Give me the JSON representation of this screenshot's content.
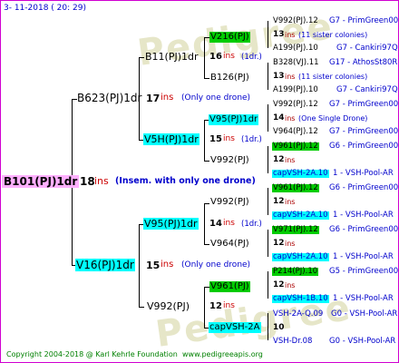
{
  "date": "3-  11-2018  (  20:  29)",
  "copyright": "Copyright 2004-2018 @ Karl Kehrle Foundation",
  "website": "www.pedigreeapis.org",
  "watermark_text": "Pedigree",
  "gen1": {
    "name": "B101(PJ)1dr",
    "ins": "18",
    "ins_label": "ins",
    "note": "(Insem. with only one drone)"
  },
  "gen2": [
    {
      "name": "B623(PJ)1dr",
      "ins": "17",
      "ins_label": "ins",
      "note": "(Only one drone)"
    },
    {
      "name": "V16(PJ)1dr",
      "ins": "15",
      "ins_label": "ins",
      "note": "(Only one drone)"
    }
  ],
  "gen3": [
    {
      "name": "B11(PJ)1dr",
      "ins": "16",
      "ins_label": "ins",
      "note": "(1dr.)"
    },
    {
      "name": "V5H(PJ)1dr",
      "ins": "15",
      "ins_label": "ins",
      "note": "(1dr.)"
    },
    {
      "name": "V95(PJ)1dr",
      "ins": "14",
      "ins_label": "ins",
      "note": "(1dr.)"
    },
    {
      "name": "V992(PJ)",
      "ins": "12",
      "ins_label": "ins",
      "note": ""
    }
  ],
  "gen4": [
    {
      "name": "V216(PJ)",
      "ins": "",
      "note": ""
    },
    {
      "name": "B126(PJ)",
      "ins": "",
      "note": ""
    },
    {
      "name": "V95(PJ)1dr",
      "ins": "15",
      "ins_label": "ins",
      "note": "(1dr.)"
    },
    {
      "name": "V992(PJ)",
      "ins": "12",
      "ins_label": "ins",
      "note": ""
    },
    {
      "name": "V992(PJ)",
      "ins": "12",
      "ins_label": "ins",
      "note": ""
    },
    {
      "name": "V964(PJ)",
      "ins": "12",
      "ins_label": "ins",
      "note": ""
    },
    {
      "name": "V961(PJ)",
      "ins": "12",
      "ins_label": "ins",
      "note": ""
    },
    {
      "name": "capVSH-2A",
      "ins": "10",
      "ins_label": "",
      "note": ""
    }
  ],
  "gen5": [
    {
      "a": "V992(PJ).12",
      "b": "G7 - PrimGreen00"
    },
    {
      "a": "13",
      "b": "ins",
      "c": "(11 sister colonies)"
    },
    {
      "a": "A199(PJ).10",
      "b": "G7 - Cankiri97Q"
    },
    {
      "a": "B328(VJ).11",
      "b": "G17 - AthosSt80R"
    },
    {
      "a": "13",
      "b": "ins",
      "c": "(11 sister colonies)"
    },
    {
      "a": "A199(PJ).10",
      "b": "G7 - Cankiri97Q"
    },
    {
      "a": "V992(PJ).12",
      "b": "G7 - PrimGreen00"
    },
    {
      "a": "14",
      "b": "ins",
      "c": "(One Single Drone)"
    },
    {
      "a": "V964(PJ).12",
      "b": "G7 - PrimGreen00"
    },
    {
      "a": "V961(PJ).12",
      "b": "G6 - PrimGreen00"
    },
    {
      "a": "12",
      "b": "ins"
    },
    {
      "a": "capVSH-2A.10",
      "b": "1 - VSH-Pool-AR"
    },
    {
      "a": "V961(PJ).12",
      "b": "G6 - PrimGreen00"
    },
    {
      "a": "12",
      "b": "ins"
    },
    {
      "a": "capVSH-2A.10",
      "b": "1 - VSH-Pool-AR"
    },
    {
      "a": "V971(PJ).12",
      "b": "G6 - PrimGreen00"
    },
    {
      "a": "12",
      "b": "ins"
    },
    {
      "a": "capVSH-2A.10",
      "b": "1 - VSH-Pool-AR"
    },
    {
      "a": "P214(PJ).10",
      "b": "G5 - PrimGreen00"
    },
    {
      "a": "12",
      "b": "ins"
    },
    {
      "a": "capVSH-1B.10",
      "b": "1 - VSH-Pool-AR"
    },
    {
      "a": "VSH-2A-Q.09",
      "b": "G0 - VSH-Pool-AR"
    },
    {
      "a": "10"
    },
    {
      "a": "VSH-Dr.08",
      "b": "G0 - VSH-Pool-AR"
    }
  ]
}
